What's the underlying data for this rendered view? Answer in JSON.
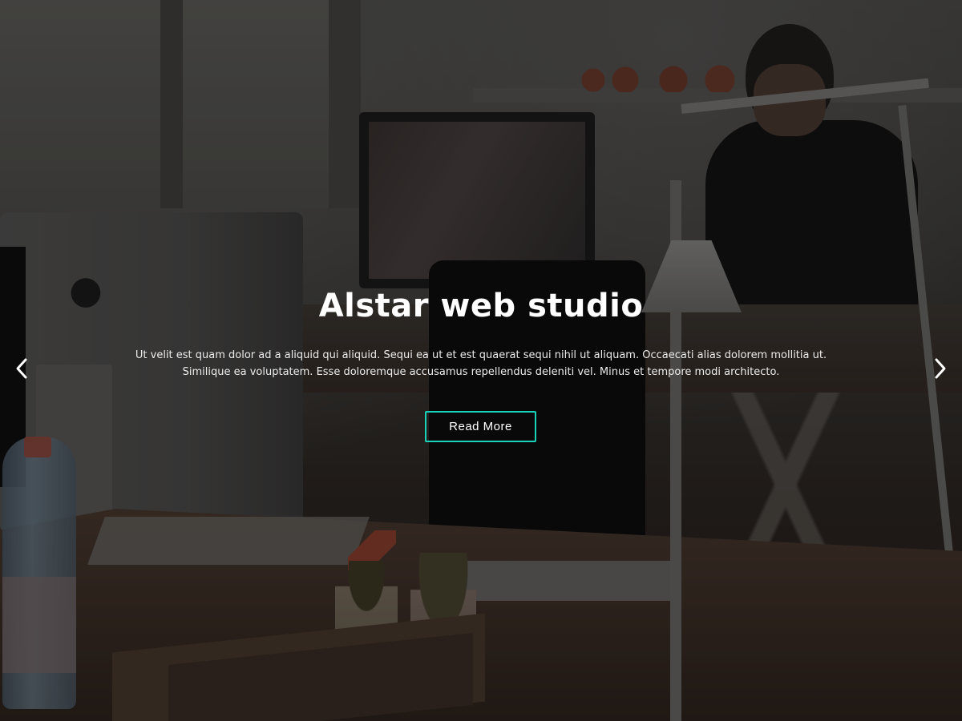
{
  "hero": {
    "title": "Alstar web studio",
    "description_line1": "Ut velit est quam dolor ad a aliquid qui aliquid. Sequi ea ut et est quaerat sequi nihil ut aliquam. Occaecati alias dolorem mollitia ut.",
    "description_line2": "Similique ea voluptatem. Esse doloremque accusamus repellendus deleniti vel. Minus et tempore modi architecto.",
    "button_label": "Read More"
  },
  "carousel": {
    "prev_icon": "chevron-left-icon",
    "next_icon": "chevron-right-icon"
  },
  "colors": {
    "accent": "#18d2ba",
    "text": "#ffffff",
    "overlay": "rgba(0,0,0,0.30)"
  }
}
